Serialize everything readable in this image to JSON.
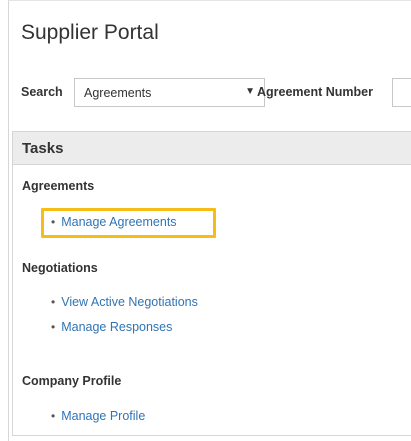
{
  "header": {
    "title": "Supplier Portal"
  },
  "search": {
    "label": "Search",
    "selected": "Agreements",
    "caret_icon": "caret-down-icon",
    "agreement_number_label": "Agreement Number",
    "agreement_number_value": ""
  },
  "tasks": {
    "title": "Tasks",
    "sections": [
      {
        "title": "Agreements",
        "links": [
          "Manage Agreements"
        ]
      },
      {
        "title": "Negotiations",
        "links": [
          "View Active Negotiations",
          "Manage Responses"
        ]
      },
      {
        "title": "Company Profile",
        "links": [
          "Manage Profile"
        ]
      }
    ]
  },
  "colors": {
    "link": "#2f74b6",
    "highlight": "#f6bd16",
    "header_bg": "#ececec"
  }
}
